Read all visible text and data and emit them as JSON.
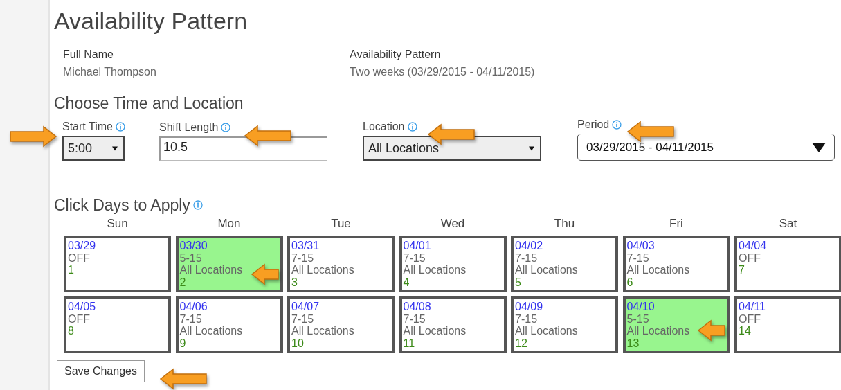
{
  "title": "Availability Pattern",
  "summary": [
    {
      "label": "Full Name",
      "value": "Michael Thompson"
    },
    {
      "label": "Availability Pattern",
      "value": "Two weeks (03/29/2015 - 04/11/2015)"
    }
  ],
  "time_section": {
    "heading": "Choose Time and Location"
  },
  "fields": [
    {
      "kind": "select",
      "label": "Start Time",
      "value": "5:00"
    },
    {
      "kind": "text",
      "label": "Shift Length",
      "value": "10.5"
    },
    {
      "kind": "select",
      "label": "Location",
      "value": "All Locations"
    },
    {
      "kind": "dropdown",
      "label": "Period",
      "value": "03/29/2015 - 04/11/2015"
    }
  ],
  "days_section": {
    "heading": "Click Days to Apply"
  },
  "weekdays": [
    "Sun",
    "Mon",
    "Tue",
    "Wed",
    "Thu",
    "Fri",
    "Sat"
  ],
  "days": [
    {
      "date": "03/29",
      "shift": "OFF",
      "number": "1",
      "selected": false
    },
    {
      "date": "03/30",
      "shift": "5-15",
      "location": "All Locations",
      "number": "2",
      "selected": true
    },
    {
      "date": "03/31",
      "shift": "7-15",
      "location": "All Locations",
      "number": "3",
      "selected": false
    },
    {
      "date": "04/01",
      "shift": "7-15",
      "location": "All Locations",
      "number": "4",
      "selected": false
    },
    {
      "date": "04/02",
      "shift": "7-15",
      "location": "All Locations",
      "number": "5",
      "selected": false
    },
    {
      "date": "04/03",
      "shift": "7-15",
      "location": "All Locations",
      "number": "6",
      "selected": false
    },
    {
      "date": "04/04",
      "shift": "OFF",
      "number": "7",
      "selected": false
    },
    {
      "date": "04/05",
      "shift": "OFF",
      "number": "8",
      "selected": false
    },
    {
      "date": "04/06",
      "shift": "7-15",
      "location": "All Locations",
      "number": "9",
      "selected": false
    },
    {
      "date": "04/07",
      "shift": "7-15",
      "location": "All Locations",
      "number": "10",
      "selected": false
    },
    {
      "date": "04/08",
      "shift": "7-15",
      "location": "All Locations",
      "number": "11",
      "selected": false
    },
    {
      "date": "04/09",
      "shift": "7-15",
      "location": "All Locations",
      "number": "12",
      "selected": false
    },
    {
      "date": "04/10",
      "shift": "5-15",
      "location": "All Locations",
      "number": "13",
      "selected": true
    },
    {
      "date": "04/11",
      "shift": "OFF",
      "number": "14",
      "selected": false
    }
  ],
  "save_button": "Save Changes"
}
